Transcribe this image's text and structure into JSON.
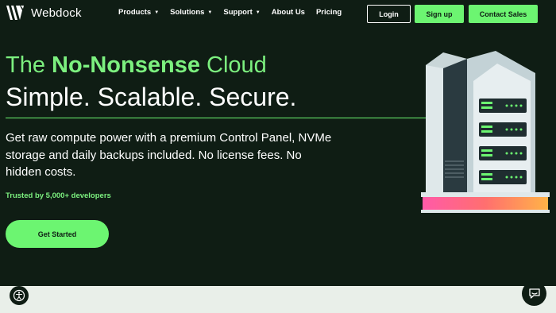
{
  "brand": {
    "name": "Webdock",
    "accent": "#6cf571",
    "background": "#0f1d14"
  },
  "nav": {
    "items": [
      {
        "label": "Products",
        "has_dropdown": true
      },
      {
        "label": "Solutions",
        "has_dropdown": true
      },
      {
        "label": "Support",
        "has_dropdown": true
      },
      {
        "label": "About Us",
        "has_dropdown": false
      },
      {
        "label": "Pricing",
        "has_dropdown": false
      }
    ],
    "login": "Login",
    "signup": "Sign up",
    "contact": "Contact Sales"
  },
  "hero": {
    "headline_prefix": "The ",
    "headline_bold": "No-Nonsense",
    "headline_suffix": " Cloud",
    "subheadline": "Simple. Scalable. Secure.",
    "description": "Get raw compute power with a premium Control Panel, NVMe storage and daily backups included. No license fees. No hidden costs.",
    "trusted": "Trusted by 5,000+ developers",
    "cta": "Get Started"
  },
  "icons": {
    "logo": "webdock-logo-icon",
    "dropdown": "chevron-down-icon",
    "accessibility": "accessibility-icon",
    "chat": "chat-icon",
    "illustration": "server-illustration"
  }
}
